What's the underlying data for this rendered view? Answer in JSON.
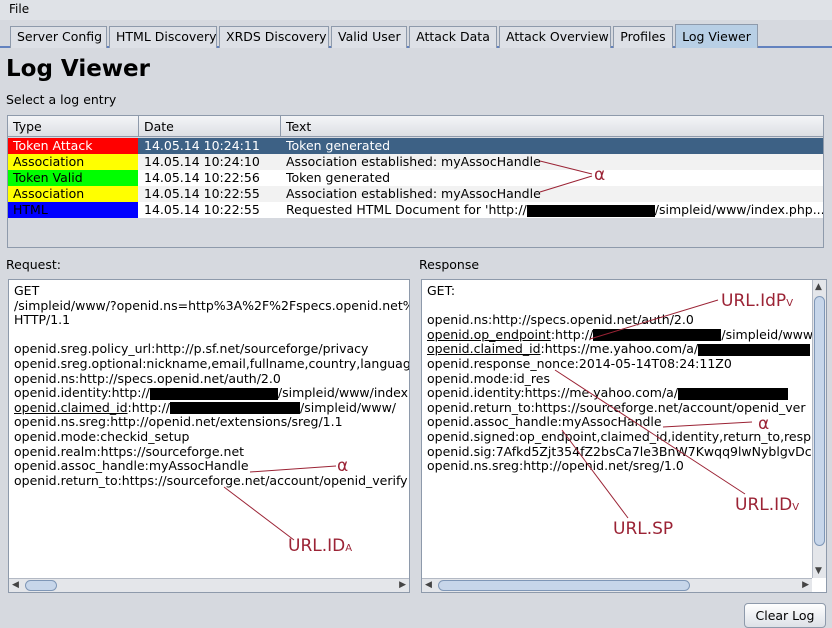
{
  "menu": {
    "file": "File"
  },
  "tabs": [
    {
      "label": "Server Config"
    },
    {
      "label": "HTML Discovery"
    },
    {
      "label": "XRDS Discovery"
    },
    {
      "label": "Valid User"
    },
    {
      "label": "Attack Data"
    },
    {
      "label": "Attack Overview"
    },
    {
      "label": "Profiles"
    },
    {
      "label": "Log Viewer",
      "active": true
    }
  ],
  "page": {
    "title": "Log Viewer",
    "subtitle": "Select a log entry"
  },
  "table": {
    "headers": [
      "Type",
      "Date",
      "Text"
    ],
    "rows": [
      {
        "type": "Token Attack",
        "type_color": "#ff0000",
        "type_text_color": "#ffffff",
        "date": "14.05.14 10:24:11",
        "text": "Token generated",
        "selected": true
      },
      {
        "type": "Association",
        "type_color": "#ffff00",
        "type_text_color": "#000000",
        "date": "14.05.14 10:24:10",
        "text": "Association established: myAssocHandle"
      },
      {
        "type": "Token Valid",
        "type_color": "#00ff00",
        "type_text_color": "#000000",
        "date": "14.05.14 10:22:56",
        "text": "Token generated"
      },
      {
        "type": "Association",
        "type_color": "#ffff00",
        "type_text_color": "#000000",
        "date": "14.05.14 10:22:55",
        "text": "Association established: myAssocHandle"
      },
      {
        "type": "HTML",
        "type_color": "#0000ff",
        "type_text_color": "#000000",
        "date": "14.05.14 10:22:55",
        "text_prefix": "Requested HTML Document for 'http://",
        "text_suffix": "/simpleid/www/index.php..."
      }
    ]
  },
  "request": {
    "label": "Request:",
    "lines": [
      "GET",
      "/simpleid/www/?openid.ns=http%3A%2F%2Fspecs.openid.net%2",
      " HTTP/1.1",
      "",
      "openid.sreg.policy_url:http://p.sf.net/sourceforge/privacy",
      "openid.sreg.optional:nickname,email,fullname,country,language",
      "openid.ns:http://specs.openid.net/auth/2.0",
      "openid.identity:http://[R]/simpleid/www/index.p",
      "openid.claimed_id:http://[R]/simpleid/www/",
      "openid.ns.sreg:http://openid.net/extensions/sreg/1.1",
      "openid.mode:checkid_setup",
      "openid.realm:https://sourceforge.net",
      "openid.assoc_handle:myAssocHandle",
      "openid.return_to:https://sourceforge.net/account/openid_verify"
    ]
  },
  "response": {
    "label": "Response",
    "lines": [
      "GET:",
      "",
      "openid.ns:http://specs.openid.net/auth/2.0",
      "openid.op_endpoint:http://[R]/simpleid/www",
      "openid.claimed_id:https://me.yahoo.com/a/[R]",
      "openid.response_nonce:2014-05-14T08:24:11Z0",
      "openid.mode:id_res",
      "openid.identity:https://me.yahoo.com/a/[R]",
      "openid.return_to:https://sourceforge.net/account/openid_ver",
      "openid.assoc_handle:myAssocHandle",
      "openid.signed:op_endpoint,claimed_id,identity,return_to,resp",
      "openid.sig:7Afkd5Zjt354fZ2bsCa7le3BnW7Kwqq9lwNyblgvDc4",
      "openid.ns.sreg:http://openid.net/sreg/1.0"
    ]
  },
  "buttons": {
    "clear_log": "Clear Log"
  },
  "annotations": {
    "alpha_table": "α",
    "alpha_request": "α",
    "alpha_response": "α",
    "url_ida": "URL.ID",
    "url_ida_sub": "A",
    "url_idp": "URL.IdP",
    "url_idp_sub": "V",
    "url_sp": "URL.SP",
    "url_idv": "URL.ID",
    "url_idv_sub": "V",
    "color": "#9b2335"
  }
}
